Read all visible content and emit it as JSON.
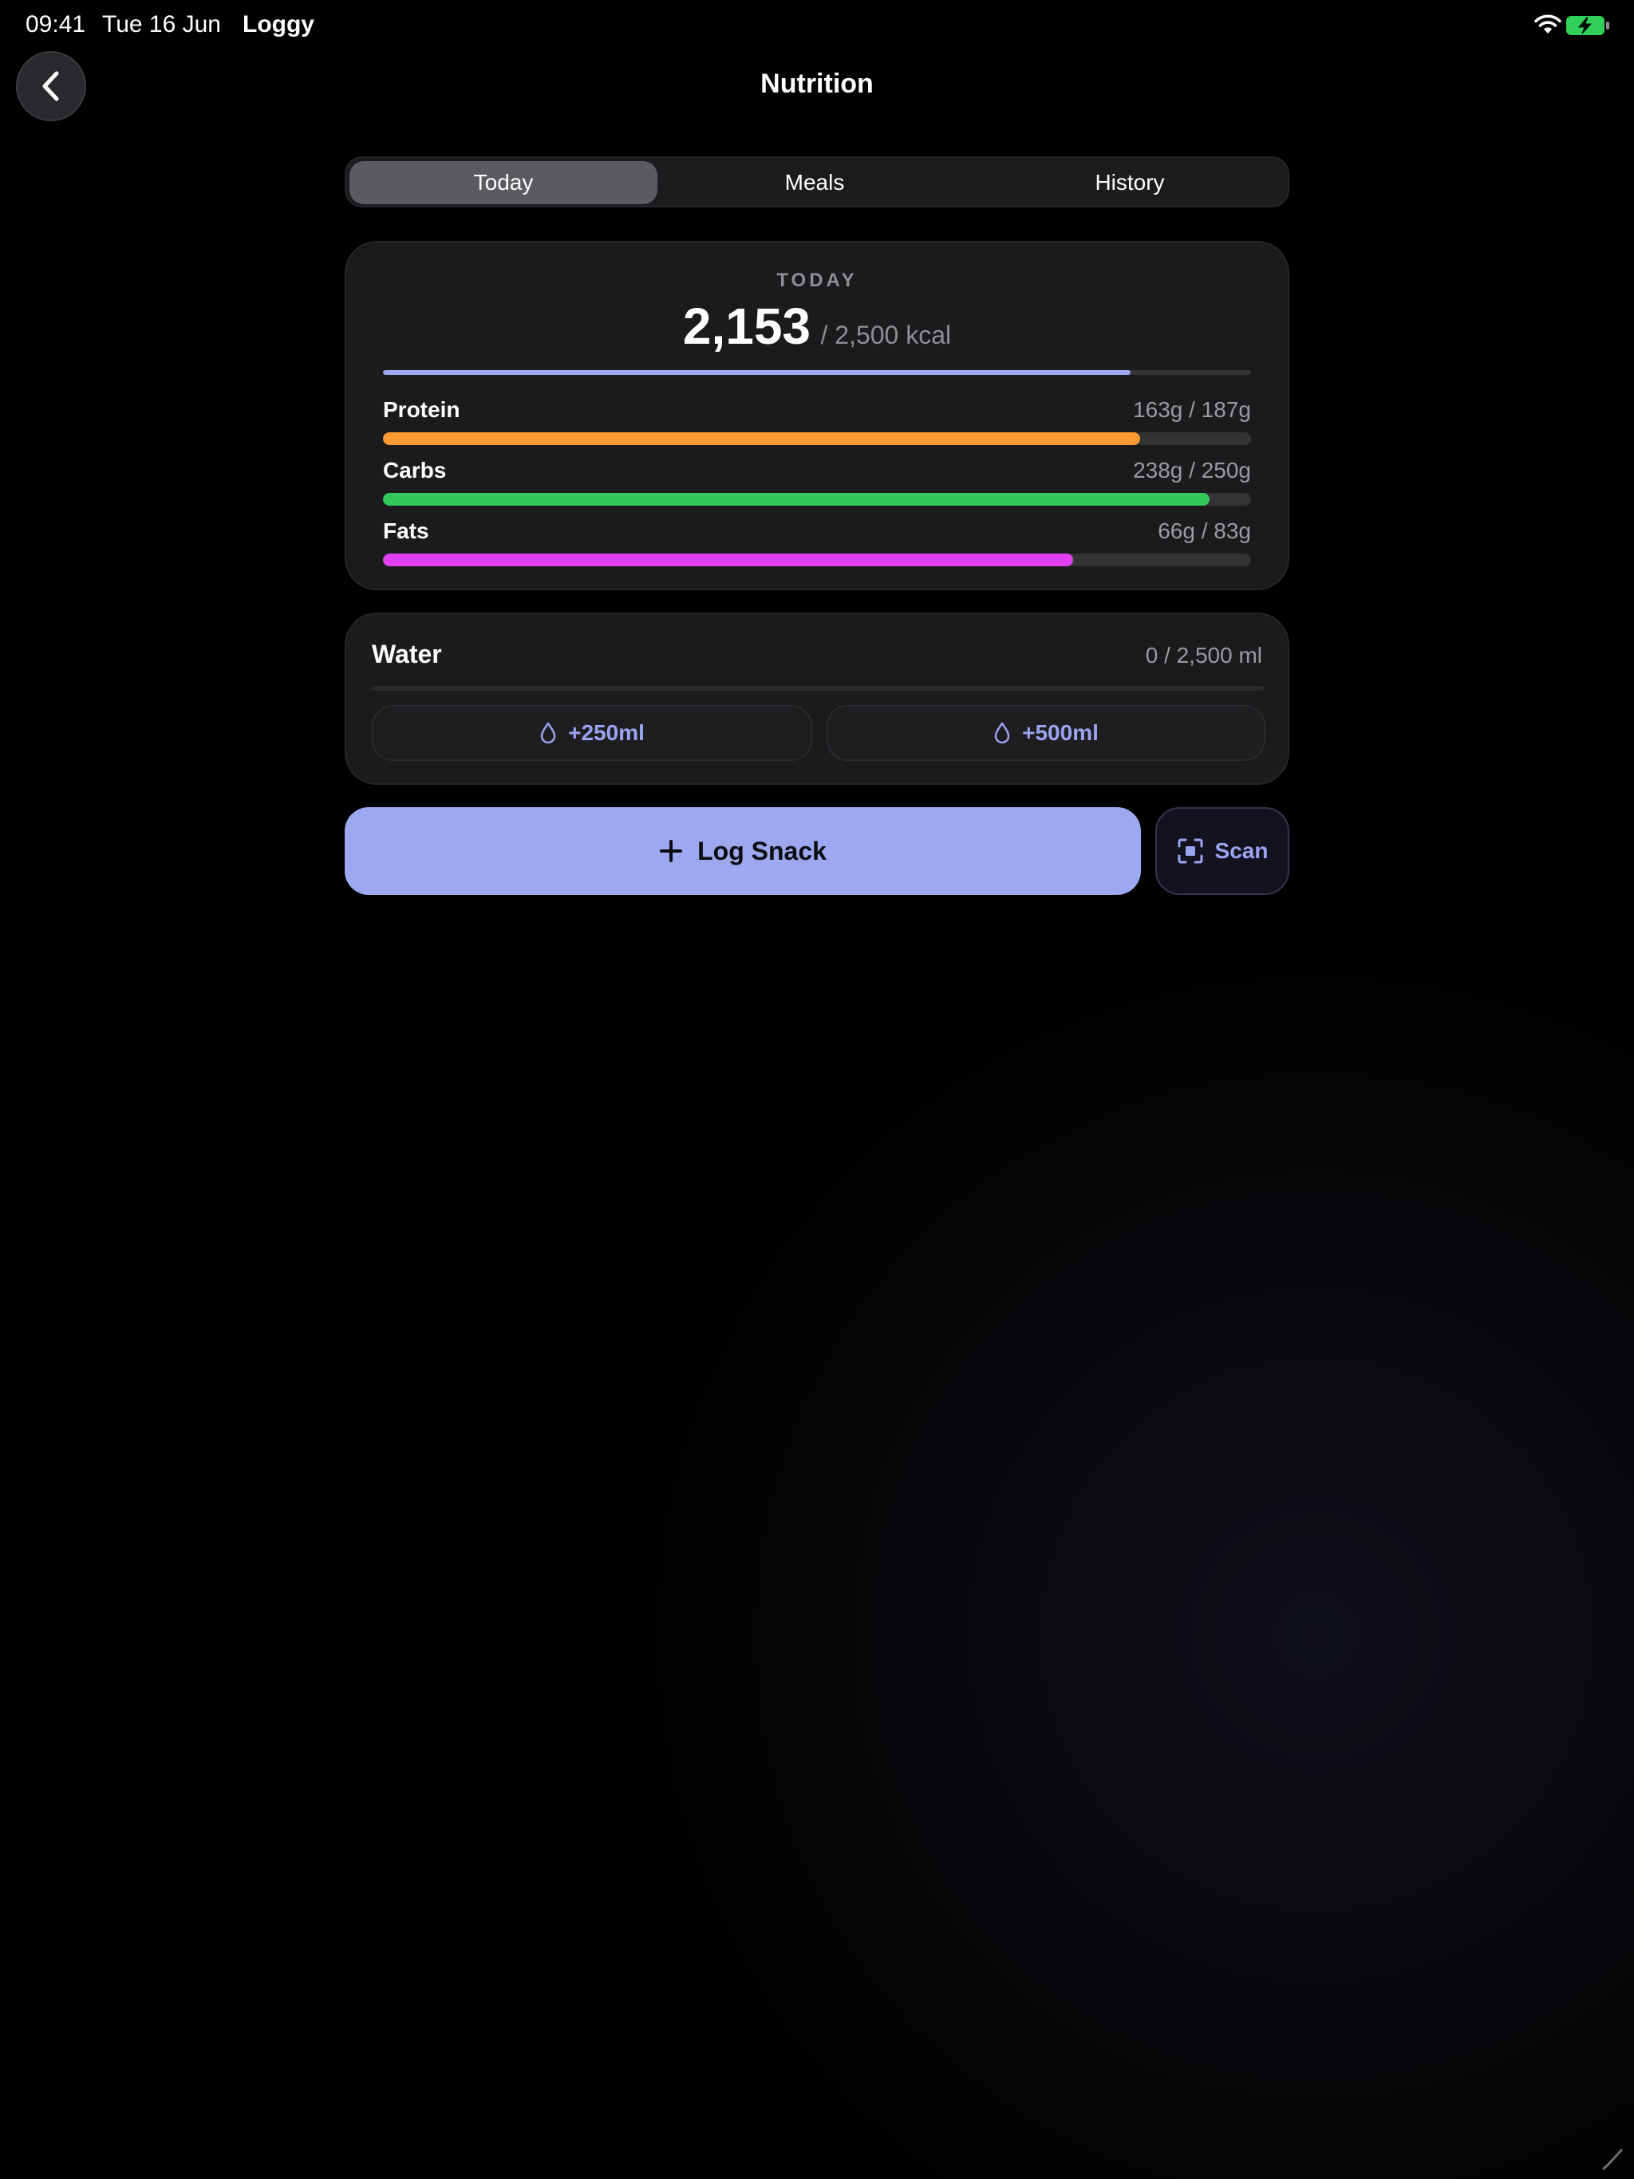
{
  "status_bar": {
    "time": "09:41",
    "date": "Tue 16 Jun",
    "app_name": "Loggy",
    "battery_color": "#30d158"
  },
  "header": {
    "title": "Nutrition",
    "back_icon": "chevron-left-icon"
  },
  "tabs": [
    {
      "label": "Today",
      "active": true
    },
    {
      "label": "Meals",
      "active": false
    },
    {
      "label": "History",
      "active": false
    }
  ],
  "today_card": {
    "label": "TODAY",
    "calories_current": "2,153",
    "calories_goal": "/ 2,500 kcal",
    "calories_progress": 0.861,
    "calories_color": "#9ca8f0",
    "macros": [
      {
        "name": "Protein",
        "value": "163g / 187g",
        "progress": 0.872,
        "color": "#ff9a32"
      },
      {
        "name": "Carbs",
        "value": "238g / 250g",
        "progress": 0.952,
        "color": "#34c759"
      },
      {
        "name": "Fats",
        "value": "66g / 83g",
        "progress": 0.795,
        "color": "#e040f0"
      }
    ]
  },
  "water_card": {
    "title": "Water",
    "value": "0 / 2,500 ml",
    "progress": 0,
    "buttons": [
      {
        "label": "+250ml",
        "icon": "water-drop-icon"
      },
      {
        "label": "+500ml",
        "icon": "water-drop-icon"
      }
    ]
  },
  "actions": {
    "log_snack_label": "Log Snack",
    "log_snack_icon": "plus-icon",
    "scan_label": "Scan",
    "scan_icon": "scan-icon",
    "accent_color": "#9ca8f0"
  }
}
